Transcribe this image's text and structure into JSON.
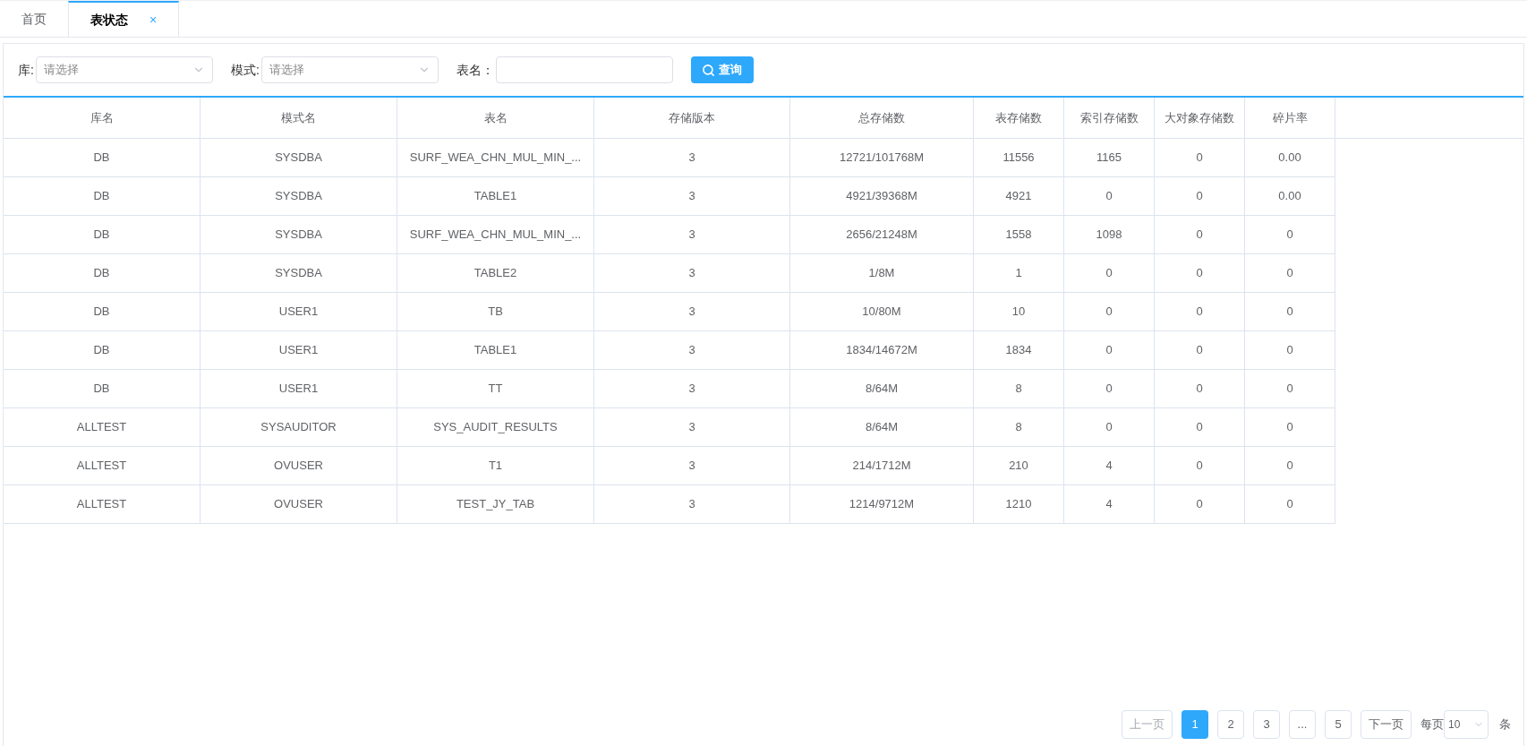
{
  "tabs": [
    {
      "label": "首页",
      "selected": false
    },
    {
      "label": "表状态",
      "selected": true,
      "close": "×"
    }
  ],
  "filters": [
    {
      "kind": "select",
      "label": "库:",
      "placeholder": "请选择"
    },
    {
      "kind": "select",
      "label": "模式:",
      "placeholder": "请选择"
    },
    {
      "kind": "input",
      "label": "表名："
    }
  ],
  "query_button": "查询",
  "table": {
    "columns": [
      "库名",
      "模式名",
      "表名",
      "存储版本",
      "总存储数",
      "表存储数",
      "索引存储数",
      "大对象存储数",
      "碎片率"
    ],
    "rows": [
      [
        "DB",
        "SYSDBA",
        "SURF_WEA_CHN_MUL_MIN_...",
        "3",
        "12721/101768M",
        "11556",
        "1165",
        "0",
        "0.00"
      ],
      [
        "DB",
        "SYSDBA",
        "TABLE1",
        "3",
        "4921/39368M",
        "4921",
        "0",
        "0",
        "0.00"
      ],
      [
        "DB",
        "SYSDBA",
        "SURF_WEA_CHN_MUL_MIN_...",
        "3",
        "2656/21248M",
        "1558",
        "1098",
        "0",
        "0"
      ],
      [
        "DB",
        "SYSDBA",
        "TABLE2",
        "3",
        "1/8M",
        "1",
        "0",
        "0",
        "0"
      ],
      [
        "DB",
        "USER1",
        "TB",
        "3",
        "10/80M",
        "10",
        "0",
        "0",
        "0"
      ],
      [
        "DB",
        "USER1",
        "TABLE1",
        "3",
        "1834/14672M",
        "1834",
        "0",
        "0",
        "0"
      ],
      [
        "DB",
        "USER1",
        "TT",
        "3",
        "8/64M",
        "8",
        "0",
        "0",
        "0"
      ],
      [
        "ALLTEST",
        "SYSAUDITOR",
        "SYS_AUDIT_RESULTS",
        "3",
        "8/64M",
        "8",
        "0",
        "0",
        "0"
      ],
      [
        "ALLTEST",
        "OVUSER",
        "T1",
        "3",
        "214/1712M",
        "210",
        "4",
        "0",
        "0"
      ],
      [
        "ALLTEST",
        "OVUSER",
        "TEST_JY_TAB",
        "3",
        "1214/9712M",
        "1210",
        "4",
        "0",
        "0"
      ]
    ]
  },
  "pagination": {
    "prev": {
      "label": "上一页",
      "disabled": true
    },
    "pages": [
      {
        "label": "1",
        "selected": true
      },
      {
        "label": "2",
        "selected": false
      },
      {
        "label": "3",
        "selected": false
      },
      {
        "label": "...",
        "selected": false
      },
      {
        "label": "5",
        "selected": false
      }
    ],
    "next": {
      "label": "下一页",
      "disabled": false
    },
    "per_page_label": "每页",
    "page_size": "10",
    "unit": "条"
  }
}
